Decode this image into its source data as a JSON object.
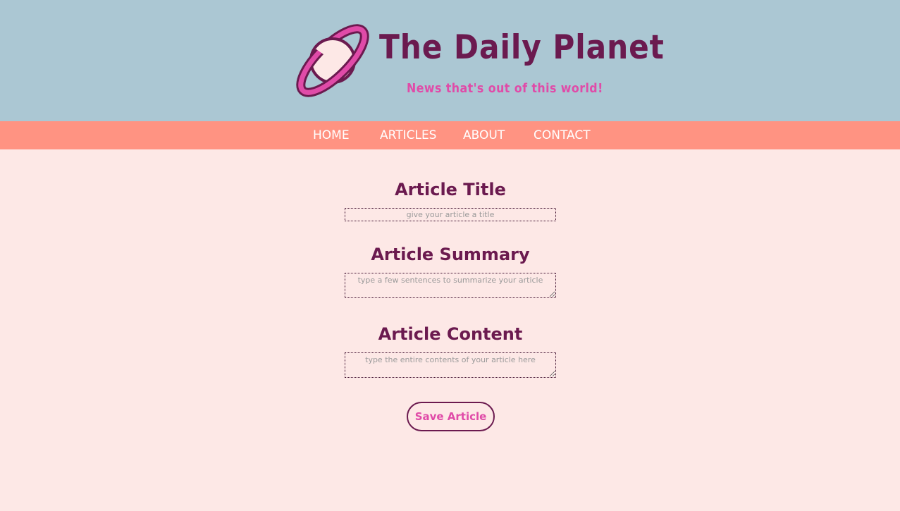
{
  "header": {
    "title": "The Daily Planet",
    "tagline": "News that's out of this world!",
    "logo_icon": "planet-icon"
  },
  "nav": {
    "items": [
      {
        "label": "HOME"
      },
      {
        "label": "ARTICLES"
      },
      {
        "label": "ABOUT"
      },
      {
        "label": "CONTACT"
      }
    ]
  },
  "form": {
    "title": {
      "label": "Article Title",
      "value": "",
      "placeholder": "give your article a title"
    },
    "summary": {
      "label": "Article Summary",
      "value": "",
      "placeholder": "type a few sentences to summarize your article"
    },
    "content": {
      "label": "Article Content",
      "value": "",
      "placeholder": "type the entire contents of your article here"
    },
    "save_label": "Save Article"
  },
  "colors": {
    "header_bg": "#abc7d3",
    "nav_bg": "#ff9382",
    "page_bg": "#fde8e6",
    "heading": "#6b1a4f",
    "accent": "#e04ba8"
  }
}
